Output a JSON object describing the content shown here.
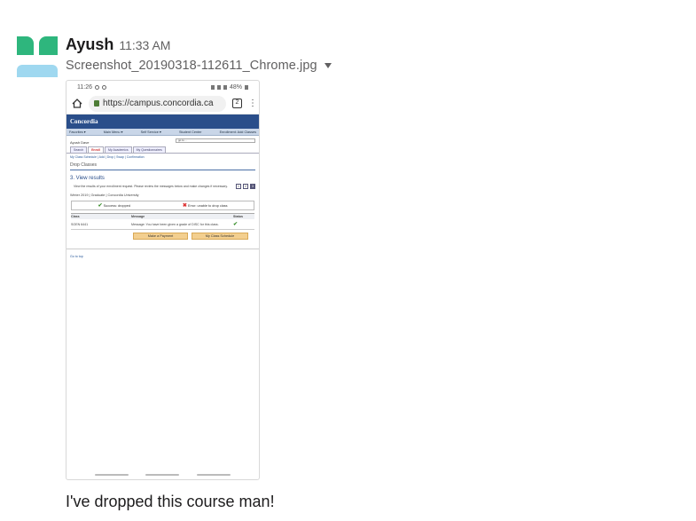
{
  "message": {
    "user": "Ayush",
    "time": "11:33 AM",
    "filename": "Screenshot_20190318-112611_Chrome.jpg",
    "text": "I've dropped this course man!"
  },
  "phone": {
    "status_time": "11:26",
    "battery": "48%",
    "url": "https://campus.concordia.ca",
    "tab_count": "2"
  },
  "campus_page": {
    "logo": "Concordia",
    "nav": [
      "Favorites ▾",
      "Main Menu ▾",
      "Self Service ▾",
      "Student Center",
      "Enrollment: Add Classes"
    ],
    "goto_placeholder": "go to ...",
    "person": "Ayush Dave",
    "tabs": [
      "Search",
      "Enroll",
      "My Academics",
      "My Questionnaires"
    ],
    "sublinks": "My Class Schedule  |  Add  |  Drop  |  Swap  |  Confirmation",
    "section": "Drop Classes",
    "steps": [
      "1",
      "2",
      "3"
    ],
    "view_title": "3.  View results",
    "description": "View the results of your enrollment request.  Please review the messages below and make changes if necessary.",
    "term": "Winter 2019 | Graduate | Concordia University",
    "success": "Success: dropped",
    "error": "Error: unable to drop class",
    "table_headers": [
      "Class",
      "Message",
      "Status"
    ],
    "row_class": "SOEN 6441",
    "row_message": "Message: You have been given a grade of DISC for this class.",
    "btn_payment": "Make a Payment",
    "btn_schedule": "My Class Schedule",
    "go_top": "Go to top"
  }
}
